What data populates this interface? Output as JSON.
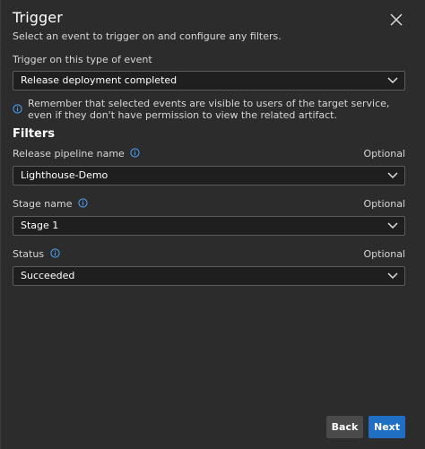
{
  "panel": {
    "title": "Trigger",
    "subtitle": "Select an event to trigger on and configure any filters."
  },
  "event": {
    "label": "Trigger on this type of event",
    "value": "Release deployment completed",
    "note": "Remember that selected events are visible to users of the target service, even if they don't have permission to view the related artifact."
  },
  "filters": {
    "heading": "Filters",
    "pipeline": {
      "label": "Release pipeline name",
      "optional": "Optional",
      "value": "Lighthouse-Demo"
    },
    "stage": {
      "label": "Stage name",
      "optional": "Optional",
      "value": "Stage 1"
    },
    "status": {
      "label": "Status",
      "optional": "Optional",
      "value": "Succeeded"
    }
  },
  "actions": {
    "back_label": "Back",
    "next_label": "Next"
  },
  "icons": {
    "close": "close-icon",
    "chevron": "chevron-down-icon",
    "info": "info-icon"
  },
  "colors": {
    "background": "#2d2c2c",
    "field": "#1f1f1f",
    "accent": "#1f6fc5",
    "info": "#4aa3ff"
  }
}
